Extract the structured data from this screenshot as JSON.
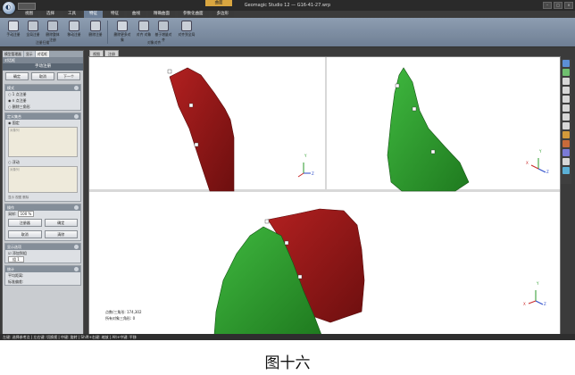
{
  "window": {
    "title": "Geomagic Studio 12 — G16-41-27.wrp",
    "context_tab": "曲面"
  },
  "menu_tabs": [
    "视图",
    "选择",
    "工具",
    "特征",
    "特征",
    "曲线",
    "精确曲面",
    "参数化曲面",
    "多边形"
  ],
  "ribbon": {
    "buttons": [
      "手动注册",
      "全局注册",
      "删除整体注册",
      "移动注册",
      "删除注册"
    ],
    "buttons2": [
      "删除更多对象",
      "对齐 对象",
      "基于增量对齐",
      "对齐到全局"
    ],
    "group1": "注册扫描",
    "group2": "对象对齐"
  },
  "left_panel": {
    "tabs": [
      "模型管理器",
      "显示",
      "对话框"
    ],
    "header": "对话框",
    "title": "手动注册",
    "buttons": {
      "ok": "确定",
      "cancel": "取消",
      "next": "下一个"
    },
    "mode": {
      "title": "模式",
      "options": [
        "1 点注册",
        "n 点注册",
        "删除三角形"
      ]
    },
    "define_set": {
      "title": "定义集合",
      "fixed": "固定",
      "floating": "浮动",
      "fixed_placeholder": "对象列",
      "floating_placeholder": "对象列"
    },
    "view_hint": "显示 视图 删除",
    "operation": {
      "title": "操作",
      "sample_label": "采样:",
      "sample_value": "100 %",
      "btn_register": "注册器",
      "btn_ok": "确定",
      "btn_result": "取消",
      "btn_clear": "清除"
    },
    "display": {
      "title": "显示选项",
      "checkbox": "添加到组",
      "group_label": "组 1"
    },
    "stats": {
      "title": "统计",
      "avg_dist": "平均距离:",
      "std_dev": "标准偏差:"
    }
  },
  "viewport": {
    "tabs": [
      "视图",
      "注册"
    ],
    "triangle_label": "点数/三角形:",
    "triangle_value": "174,302",
    "object_label": "所有对象三角形:",
    "object_value": "0",
    "axis_x": "X",
    "axis_y": "Y",
    "axis_z": "Z"
  },
  "status_bar": "左键: 选择参考点  |  左右键: 切换视  |  中键: 旋转  |  Shift+右键: 缩放  |  Alt+中键: 平移",
  "caption": "图十六",
  "colors": {
    "red_mesh": "#8b1a1a",
    "green_mesh": "#2f9a2f",
    "ribbon": "#7f8fa3"
  }
}
